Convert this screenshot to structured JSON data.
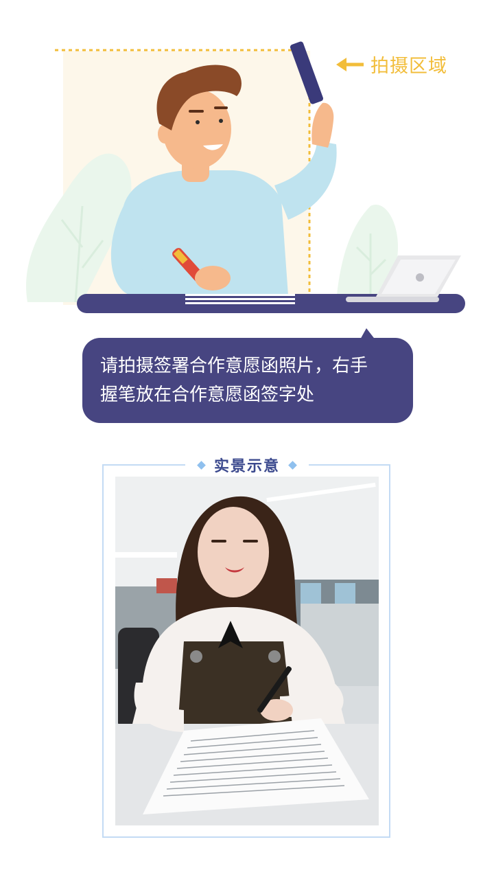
{
  "capture_area_label": "拍摄区域",
  "instruction": {
    "line1": "请拍摄签署合作意愿函照片，右手",
    "line2": "握笔放在合作意愿函签字处"
  },
  "example": {
    "title": "实景示意"
  },
  "colors": {
    "accent_yellow": "#f2bd3a",
    "bubble_bg": "#474581",
    "frame_border": "#c3dbf4",
    "title_text": "#3c4a8e"
  },
  "icons": {
    "arrow": "arrow-left-icon",
    "diamond": "diamond-icon"
  }
}
